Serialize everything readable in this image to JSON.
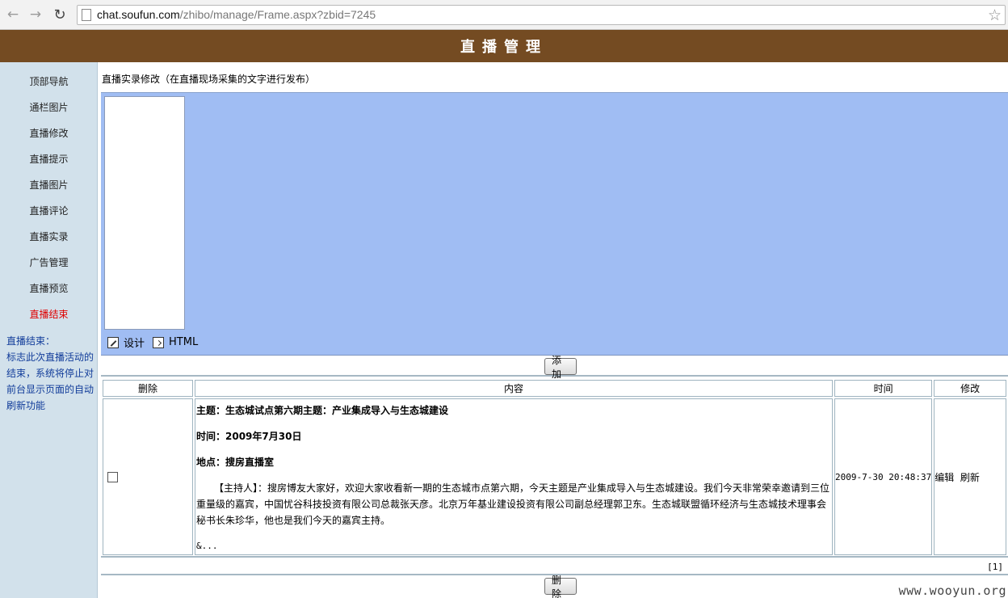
{
  "browser": {
    "url_host": "chat.soufun.com",
    "url_path": "/zhibo/manage/Frame.aspx?zbid=7245"
  },
  "banner": {
    "title": "直播管理"
  },
  "sidebar": {
    "items": [
      {
        "label": "顶部导航"
      },
      {
        "label": "通栏图片"
      },
      {
        "label": "直播修改"
      },
      {
        "label": "直播提示"
      },
      {
        "label": "直播图片"
      },
      {
        "label": "直播评论"
      },
      {
        "label": "直播实录"
      },
      {
        "label": "广告管理"
      },
      {
        "label": "直播预览"
      },
      {
        "label": "直播结束"
      }
    ],
    "help": {
      "title": "直播结束：",
      "body": "标志此次直播活动的结束，系统将停止对前台显示页面的自动刷新功能"
    }
  },
  "main": {
    "section_title": "直播实录修改（在直播现场采集的文字进行发布）",
    "editor_tabs": {
      "design": "设计",
      "html": "HTML"
    },
    "add_button": "添加",
    "table": {
      "headers": {
        "delete": "删除",
        "content": "内容",
        "time": "时间",
        "modify": "修改"
      },
      "row": {
        "topic": "主题：生态城试点第六期主题：产业集成导入与生态城建设",
        "date": "时间：2009年7月30日",
        "place": "地点：搜房直播室",
        "body": "【主持人】：搜房博友大家好，欢迎大家收看新一期的生态城市点第六期，今天主题是产业集成导入与生态城建设。我们今天非常荣幸邀请到三位重量级的嘉宾，中国忧谷科技投资有限公司总裁张天彦。北京万年基业建设投资有限公司副总经理郭卫东。生态城联盟循环经济与生态城技术理事会秘书长朱珍华，他也是我们今天的嘉宾主持。",
        "more": "&...",
        "time": "2009-7-30 20:48:37",
        "edit": "编辑",
        "refresh": "刷新"
      }
    },
    "pager": "[1]",
    "delete_button": "删除"
  },
  "watermark": "www.wooyun.org"
}
